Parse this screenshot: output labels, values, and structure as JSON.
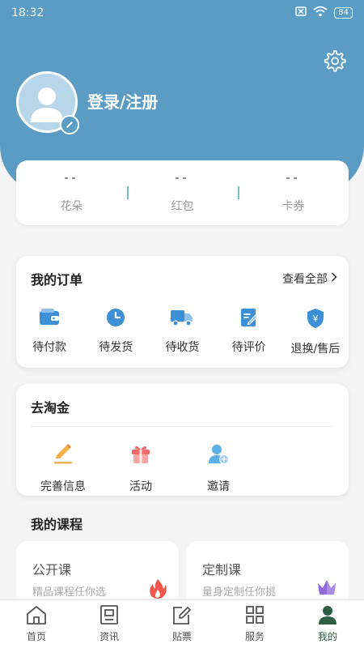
{
  "status_bar": {
    "time": "18:32",
    "battery": "84"
  },
  "profile": {
    "login_label": "登录/注册"
  },
  "stats": [
    {
      "value": "--",
      "label": "花朵"
    },
    {
      "value": "--",
      "label": "红包"
    },
    {
      "value": "--",
      "label": "卡券"
    }
  ],
  "orders": {
    "title": "我的订单",
    "view_all": "查看全部",
    "items": [
      {
        "label": "待付款",
        "icon": "wallet-icon"
      },
      {
        "label": "待发货",
        "icon": "clock-icon"
      },
      {
        "label": "待收货",
        "icon": "truck-icon"
      },
      {
        "label": "待评价",
        "icon": "review-icon"
      },
      {
        "label": "退换/售后",
        "icon": "shield-yen-icon"
      }
    ]
  },
  "gold": {
    "title": "去淘金",
    "items": [
      {
        "label": "完善信息",
        "icon": "pencil-icon"
      },
      {
        "label": "活动",
        "icon": "gift-icon"
      },
      {
        "label": "邀请",
        "icon": "invite-user-icon"
      }
    ]
  },
  "courses": {
    "title": "我的课程",
    "items": [
      {
        "name": "公开课",
        "desc": "精品课程任你选",
        "icon": "flame-icon"
      },
      {
        "name": "定制课",
        "desc": "量身定制任你挑",
        "icon": "crown-icon"
      }
    ]
  },
  "bottom_nav": [
    {
      "label": "首页",
      "icon": "home-icon"
    },
    {
      "label": "资讯",
      "icon": "news-icon"
    },
    {
      "label": "贴票",
      "icon": "edit-icon"
    },
    {
      "label": "服务",
      "icon": "grid-icon"
    },
    {
      "label": "我的",
      "icon": "profile-icon",
      "active": true
    }
  ],
  "colors": {
    "header": "#5b9cc5",
    "order_icon": "#3d8fd6",
    "active_nav": "#2f5e45"
  }
}
